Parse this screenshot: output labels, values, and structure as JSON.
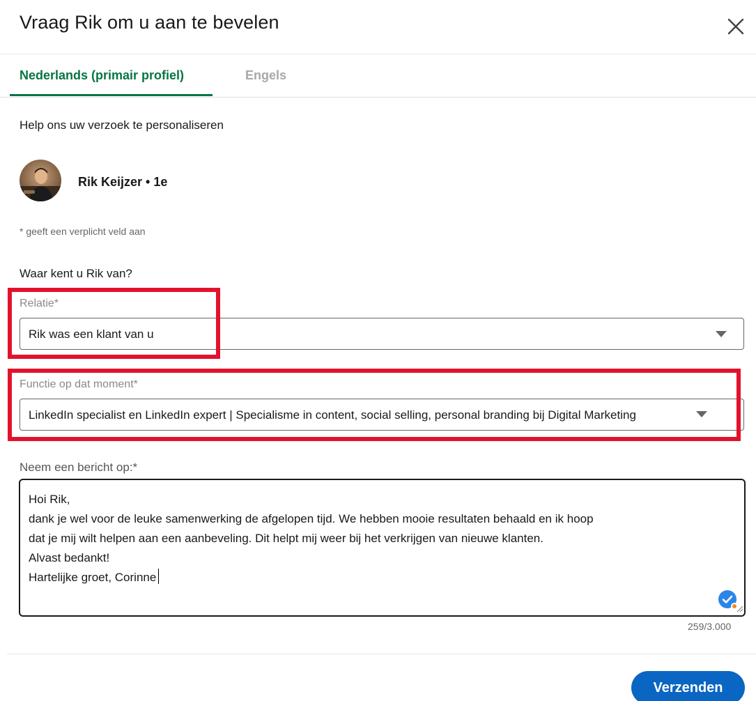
{
  "dialog": {
    "title": "Vraag Rik om u aan te bevelen",
    "close_icon": "close-icon"
  },
  "tabs": [
    {
      "label": "Nederlands (primair profiel)",
      "active": true
    },
    {
      "label": "Engels",
      "active": false
    }
  ],
  "help_text": "Help ons uw verzoek te personaliseren",
  "person": {
    "name_degree": "Rik Keijzer • 1e",
    "avatar_icon": "avatar"
  },
  "required_note": "* geeft een verplicht veld aan",
  "question": "Waar kent u Rik van?",
  "fields": {
    "relatie": {
      "label": "Relatie*",
      "value": "Rik was een klant van u"
    },
    "functie": {
      "label": "Functie op dat moment*",
      "value": "LinkedIn specialist en LinkedIn expert | Specialisme in content, social selling, personal branding bij Digital Marketing"
    },
    "bericht": {
      "label": "Neem een bericht op:*",
      "lines": [
        "Hoi Rik,",
        "dank je wel voor de leuke samenwerking de afgelopen tijd. We hebben mooie resultaten behaald en ik hoop",
        "dat je mij wilt helpen aan een aanbeveling. Dit helpt mij weer bij het verkrijgen van nieuwe klanten.",
        "Alvast bedankt!",
        "Hartelijke groet, Corinne"
      ],
      "counter": "259/3.000"
    }
  },
  "send_button": "Verzenden",
  "colors": {
    "accent_green": "#057642",
    "primary_blue": "#0a66c2",
    "highlight_red": "#e3122c"
  }
}
